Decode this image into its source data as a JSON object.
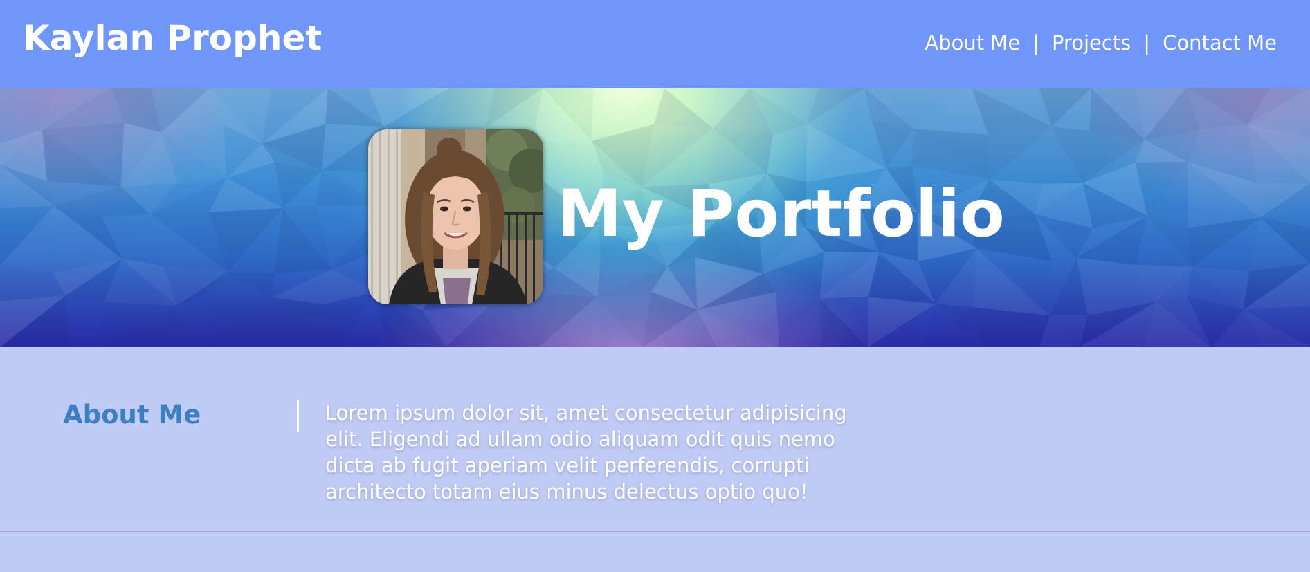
{
  "header": {
    "site_title": "Kaylan Prophet",
    "nav": [
      {
        "label": "About Me"
      },
      {
        "label": "Projects"
      },
      {
        "label": "Contact Me"
      }
    ],
    "separator": "|"
  },
  "hero": {
    "heading": "My Portfolio",
    "photo": "portrait-photo"
  },
  "about": {
    "heading": "About Me",
    "text": "Lorem ipsum dolor sit, amet consectetur adipisicing elit. Eligendi ad ullam odio aliquam odit quis nemo dicta ab fugit aperiam velit perferendis, corrupti architecto totam eius minus delectus optio quo!"
  },
  "colors": {
    "header_bg": "#7096fb",
    "page_bg": "#c0cbf5",
    "accent_heading": "#3d7fc0",
    "text": "#ffffff"
  }
}
